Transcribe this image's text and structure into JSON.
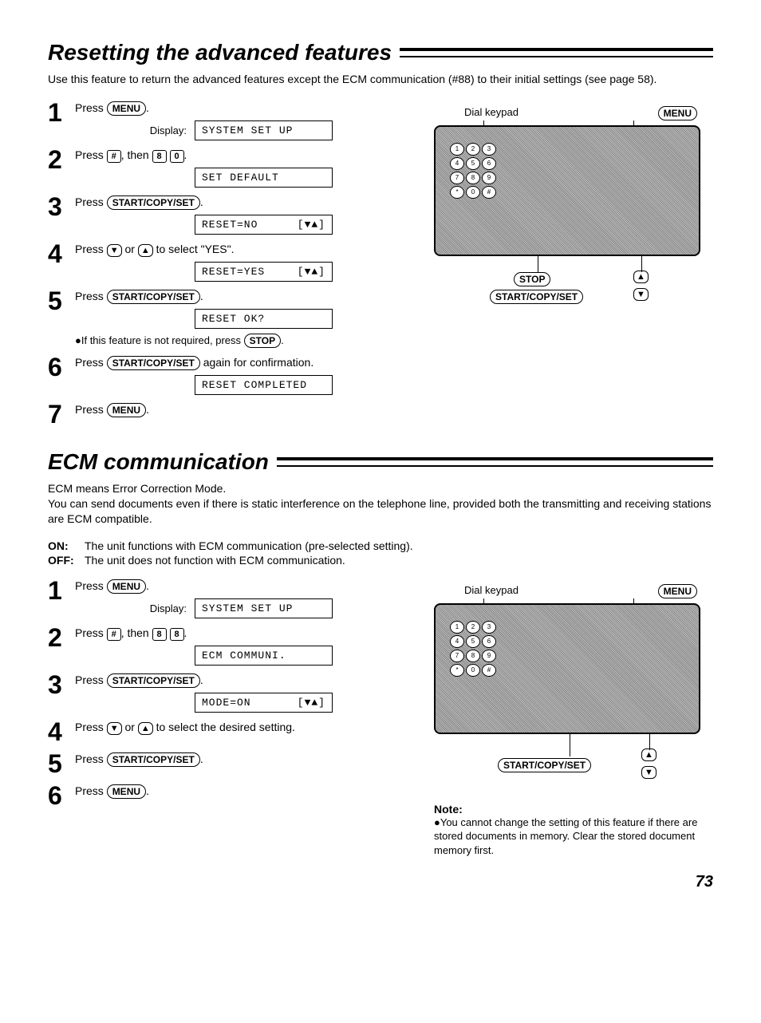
{
  "section1": {
    "title": "Resetting the advanced features",
    "intro": "Use this feature to return the advanced features except the ECM communication (#88) to their initial settings (see page 58).",
    "steps": [
      {
        "num": "1",
        "pre": "Press ",
        "btn": "MENU",
        "post": ".",
        "displayLabel": "Display:",
        "display": "SYSTEM SET UP"
      },
      {
        "num": "2",
        "pre": "Press ",
        "key1": "#",
        "mid": ", then ",
        "key2": "8",
        "key3": "0",
        "post": ".",
        "display": "SET DEFAULT"
      },
      {
        "num": "3",
        "pre": "Press ",
        "btn": "START/COPY/SET",
        "post": ".",
        "display": "RESET=NO",
        "arrows": "[▼▲]"
      },
      {
        "num": "4",
        "pre": "Press ",
        "arrowDown": "▼",
        "mid": " or ",
        "arrowUp": "▲",
        "post2": " to select \"YES\".",
        "display": "RESET=YES",
        "arrows": "[▼▲]"
      },
      {
        "num": "5",
        "pre": "Press ",
        "btn": "START/COPY/SET",
        "post": ".",
        "display": "RESET OK?",
        "note": "●If this feature is not required, press ",
        "noteBtn": "STOP",
        "notePost": "."
      },
      {
        "num": "6",
        "pre": "Press ",
        "btn": "START/COPY/SET",
        "post": " again for confirmation.",
        "display": "RESET COMPLETED"
      },
      {
        "num": "7",
        "pre": "Press ",
        "btn": "MENU",
        "post": "."
      }
    ],
    "device": {
      "dialKeypad": "Dial keypad",
      "menu": "MENU",
      "stop": "STOP",
      "startCopySet": "START/COPY/SET"
    }
  },
  "section2": {
    "title": "ECM communication",
    "intro": "ECM means Error Correction Mode.\nYou can send documents even if there is static interference on the telephone line, provided both the transmitting and receiving stations are ECM compatible.",
    "on": {
      "label": "ON:",
      "text": "The unit functions with ECM communication (pre-selected setting)."
    },
    "off": {
      "label": "OFF:",
      "text": "The unit does not function with ECM communication."
    },
    "steps": [
      {
        "num": "1",
        "pre": "Press ",
        "btn": "MENU",
        "post": ".",
        "displayLabel": "Display:",
        "display": "SYSTEM SET UP"
      },
      {
        "num": "2",
        "pre": "Press ",
        "key1": "#",
        "mid": ", then ",
        "key2": "8",
        "key3": "8",
        "post": ".",
        "display": "ECM COMMUNI."
      },
      {
        "num": "3",
        "pre": "Press ",
        "btn": "START/COPY/SET",
        "post": ".",
        "display": "MODE=ON",
        "arrows": "[▼▲]"
      },
      {
        "num": "4",
        "pre": "Press ",
        "arrowDown": "▼",
        "mid": " or ",
        "arrowUp": "▲",
        "post2": " to select the desired setting."
      },
      {
        "num": "5",
        "pre": "Press ",
        "btn": "START/COPY/SET",
        "post": "."
      },
      {
        "num": "6",
        "pre": "Press ",
        "btn": "MENU",
        "post": "."
      }
    ],
    "device": {
      "dialKeypad": "Dial keypad",
      "menu": "MENU",
      "startCopySet": "START/COPY/SET"
    },
    "note": {
      "head": "Note:",
      "body": "●You cannot change the setting of this feature if there are stored documents in memory. Clear the stored document memory first."
    }
  },
  "pageNumber": "73",
  "keypad": [
    "1",
    "2",
    "3",
    "4",
    "5",
    "6",
    "7",
    "8",
    "9",
    "*",
    "0",
    "#"
  ]
}
